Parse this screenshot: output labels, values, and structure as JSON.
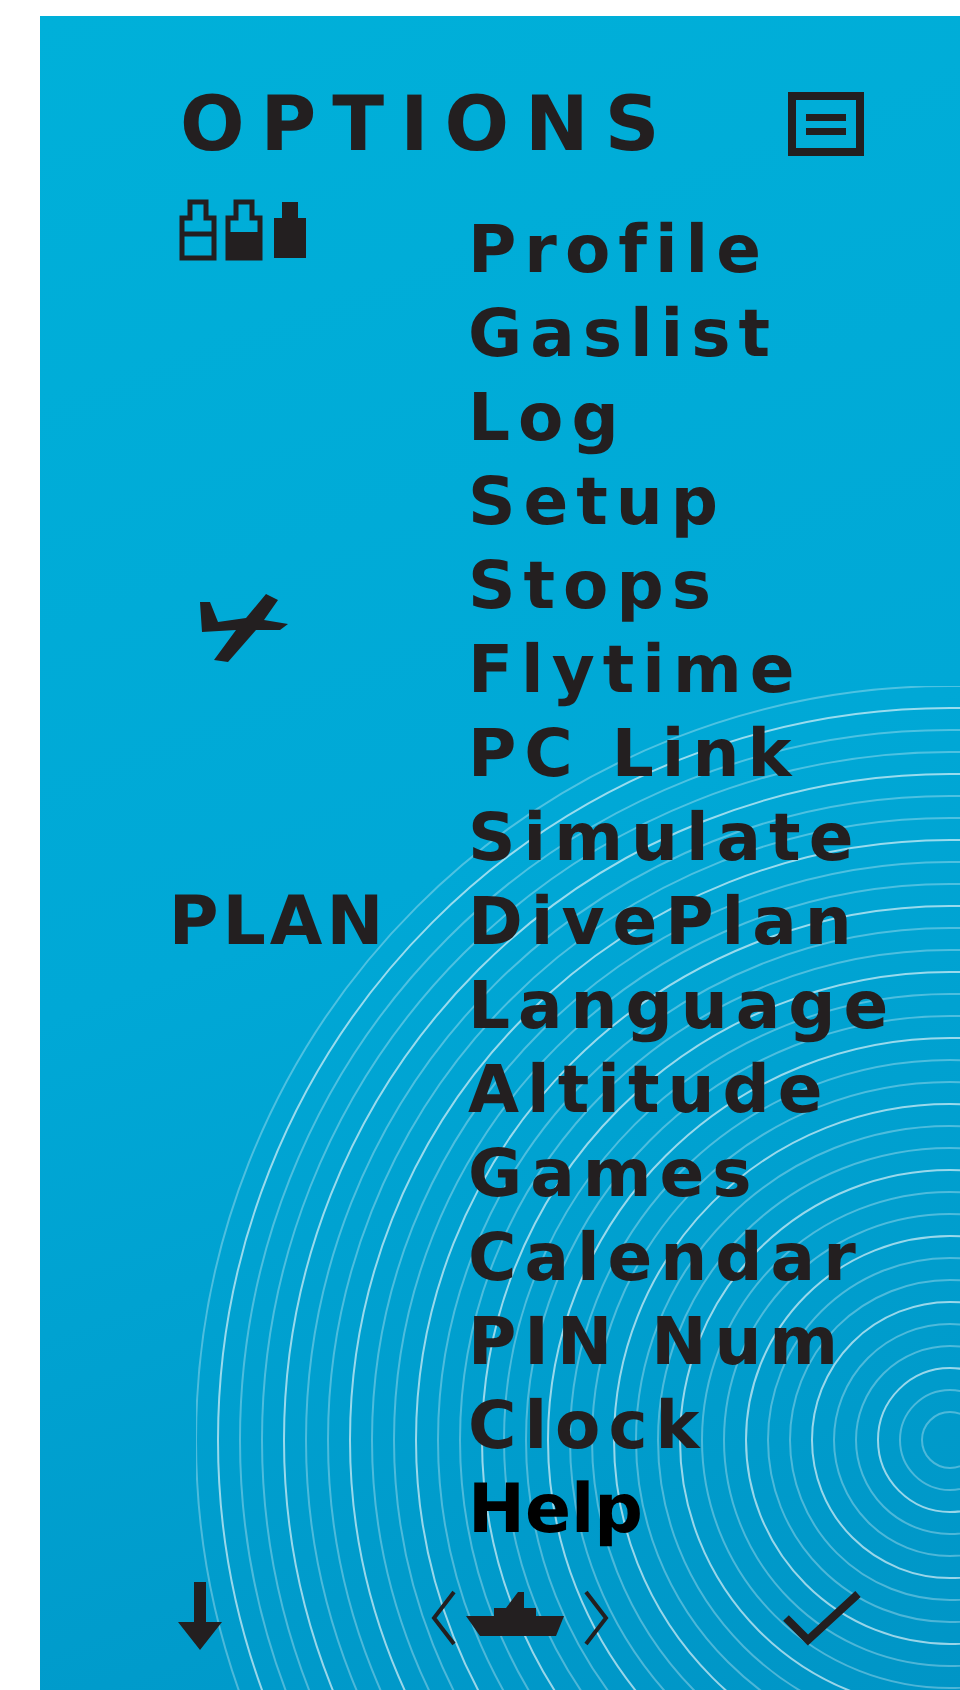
{
  "header": {
    "title": "OPTIONS"
  },
  "items": [
    {
      "label": "Profile",
      "selected": false,
      "side": {
        "kind": "tanks"
      }
    },
    {
      "label": "Gaslist",
      "selected": false
    },
    {
      "label": "Log",
      "selected": false
    },
    {
      "label": "Setup",
      "selected": false
    },
    {
      "label": "Stops",
      "selected": false
    },
    {
      "label": "Flytime",
      "selected": false,
      "side": {
        "kind": "plane"
      }
    },
    {
      "label": "PC Link",
      "selected": false
    },
    {
      "label": "Simulate",
      "selected": false
    },
    {
      "label": "DivePlan",
      "selected": false,
      "side": {
        "kind": "text",
        "text": "PLAN"
      }
    },
    {
      "label": "Language",
      "selected": false
    },
    {
      "label": "Altitude",
      "selected": false
    },
    {
      "label": "Games",
      "selected": false
    },
    {
      "label": "Calendar",
      "selected": false
    },
    {
      "label": "PIN Num",
      "selected": false
    },
    {
      "label": "Clock",
      "selected": false
    },
    {
      "label": "Help",
      "selected": true
    }
  ]
}
